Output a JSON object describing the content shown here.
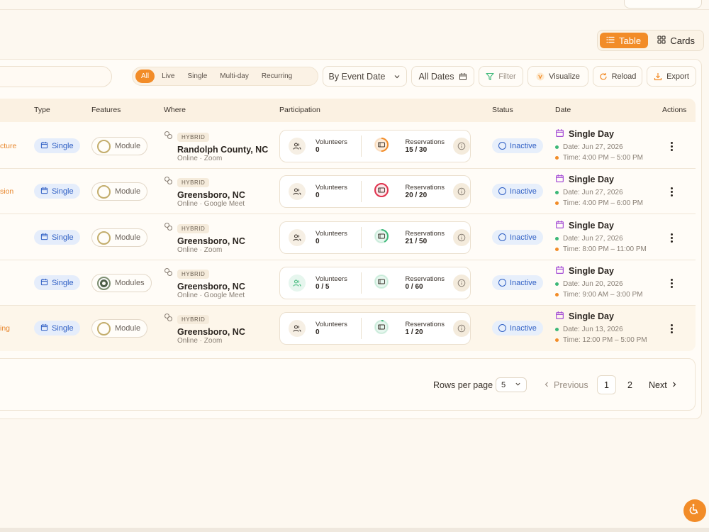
{
  "view_toggle": {
    "table_label": "Table",
    "cards_label": "Cards"
  },
  "filters": {
    "chips": [
      {
        "label": "All",
        "active": true
      },
      {
        "label": "Live",
        "active": false
      },
      {
        "label": "Single",
        "active": false
      },
      {
        "label": "Multi-day",
        "active": false
      },
      {
        "label": "Recurring",
        "active": false
      }
    ],
    "sort_select": "By Event Date",
    "dates_select": "All Dates",
    "filter_label": "Filter",
    "visualize_label": "Visualize",
    "reload_label": "Reload",
    "export_label": "Export"
  },
  "table": {
    "headers": {
      "type": "Type",
      "features": "Features",
      "where": "Where",
      "participation": "Participation",
      "status": "Status",
      "date": "Date",
      "actions": "Actions"
    },
    "rows": [
      {
        "title_fragment": "cture",
        "type": "Single",
        "feature": "Module",
        "where_tag": "HYBRID",
        "where_main": "Randolph County, NC",
        "where_sub": "Online · Zoom",
        "volunteers_label": "Volunteers",
        "volunteers_value": "0",
        "reservations_label": "Reservations",
        "reservations_value": "15 / 30",
        "reservations_fill": 0.5,
        "reservations_color": "#f28c28",
        "volunteers_has_target": false,
        "status": "Inactive",
        "date_title": "Single Day",
        "date_line": "Date: Jun 27, 2026",
        "time_line": "Time: 4:00 PM – 5:00 PM"
      },
      {
        "title_fragment": "sion",
        "type": "Single",
        "feature": "Module",
        "where_tag": "HYBRID",
        "where_main": "Greensboro, NC",
        "where_sub": "Online · Google Meet",
        "volunteers_label": "Volunteers",
        "volunteers_value": "0",
        "reservations_label": "Reservations",
        "reservations_value": "20 / 20",
        "reservations_fill": 1.0,
        "reservations_color": "#e0344f",
        "volunteers_has_target": false,
        "status": "Inactive",
        "date_title": "Single Day",
        "date_line": "Date: Jun 27, 2026",
        "time_line": "Time: 4:00 PM – 6:00 PM"
      },
      {
        "title_fragment": "",
        "type": "Single",
        "feature": "Module",
        "where_tag": "HYBRID",
        "where_main": "Greensboro, NC",
        "where_sub": "Online · Zoom",
        "volunteers_label": "Volunteers",
        "volunteers_value": "0",
        "reservations_label": "Reservations",
        "reservations_value": "21 / 50",
        "reservations_fill": 0.42,
        "reservations_color": "#3cb878",
        "volunteers_has_target": false,
        "status": "Inactive",
        "date_title": "Single Day",
        "date_line": "Date: Jun 27, 2026",
        "time_line": "Time: 8:00 PM – 11:00 PM"
      },
      {
        "title_fragment": "",
        "type": "Single",
        "feature": "Modules",
        "feature_ok": true,
        "where_tag": "HYBRID",
        "where_main": "Greensboro, NC",
        "where_sub": "Online · Google Meet",
        "volunteers_label": "Volunteers",
        "volunteers_value": "0 / 5",
        "reservations_label": "Reservations",
        "reservations_value": "0 / 60",
        "reservations_fill": 0.0,
        "reservations_color": "#3cb878",
        "volunteers_has_target": true,
        "status": "Inactive",
        "date_title": "Single Day",
        "date_line": "Date: Jun 20, 2026",
        "time_line": "Time: 9:00 AM – 3:00 PM"
      },
      {
        "title_fragment": "ing",
        "type": "Single",
        "feature": "Module",
        "where_tag": "HYBRID",
        "where_main": "Greensboro, NC",
        "where_sub": "Online · Zoom",
        "volunteers_label": "Volunteers",
        "volunteers_value": "0",
        "reservations_label": "Reservations",
        "reservations_value": "1 / 20",
        "reservations_fill": 0.05,
        "reservations_color": "#3cb878",
        "volunteers_has_target": false,
        "status": "Inactive",
        "date_title": "Single Day",
        "date_line": "Date: Jun 13, 2026",
        "time_line": "Time: 12:00 PM – 5:00 PM"
      }
    ]
  },
  "pagination": {
    "rows_per_page_label": "Rows per page",
    "rows_per_page_value": "5",
    "previous_label": "Previous",
    "pages": [
      "1",
      "2"
    ],
    "current_page": "1",
    "next_label": "Next"
  },
  "colors": {
    "accent": "#f28c28",
    "status_blue": "#2f5fc4",
    "date_purple": "#a64fd6",
    "dot_green": "#3cb878",
    "dot_orange": "#f28c28"
  }
}
